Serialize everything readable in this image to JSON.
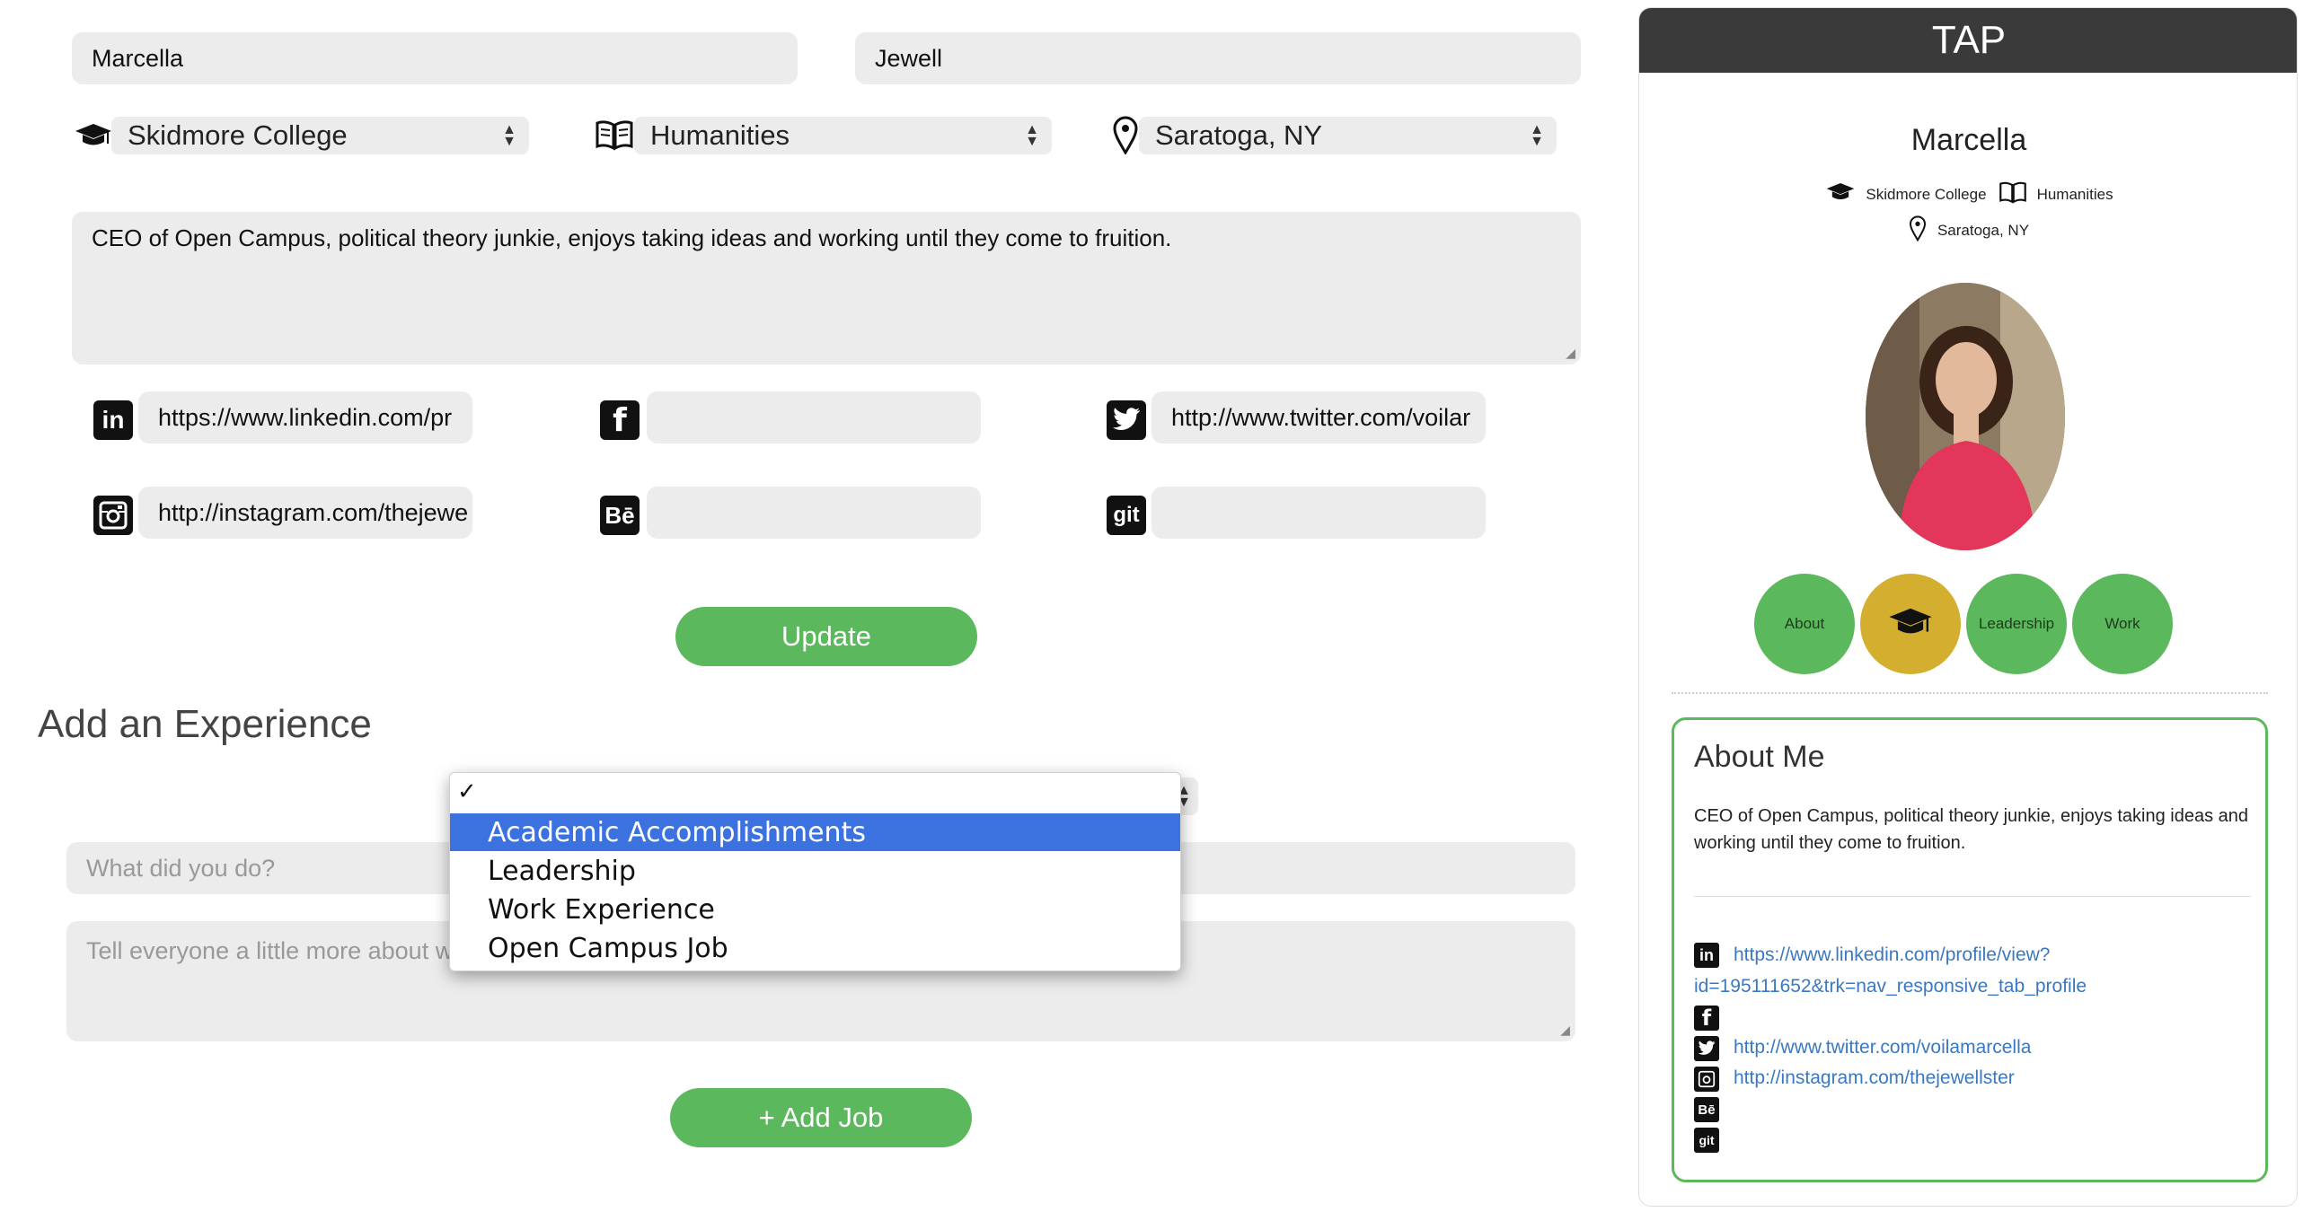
{
  "form": {
    "first_name": "Marcella",
    "last_name": "Jewell",
    "college": "Skidmore College",
    "major": "Humanities",
    "location": "Saratoga, NY",
    "bio": "CEO of Open Campus, political theory junkie, enjoys taking ideas and working until they come to fruition.",
    "linkedin_value": "https://www.linkedin.com/pr",
    "facebook_value": "",
    "twitter_value": "http://www.twitter.com/voilar",
    "instagram_value": "http://instagram.com/thejewe",
    "behance_value": "",
    "github_value": "",
    "update_label": "Update"
  },
  "experience": {
    "heading": "Add an Experience",
    "title_placeholder": "What did you do?",
    "details_placeholder": "Tell everyone a little more about w",
    "add_job_label": "+ Add Job",
    "dropdown": {
      "checkmark": "✓",
      "options": [
        "Academic Accomplishments",
        "Leadership",
        "Work Experience",
        "Open Campus Job"
      ],
      "highlighted": "Academic Accomplishments"
    }
  },
  "preview": {
    "header_title": "TAP",
    "name": "Marcella",
    "college": "Skidmore College",
    "major": "Humanities",
    "location": "Saratoga, NY",
    "tabs": [
      "About",
      "",
      "Leadership",
      "Work"
    ],
    "about_title": "About Me",
    "about_text": "CEO of Open Campus, political theory junkie, enjoys taking ideas and working until they come to fruition.",
    "linkedin_url_line1": "https://www.linkedin.com/profile/view?",
    "linkedin_url_line2": "id=195111652&trk=nav_responsive_tab_profile",
    "twitter_url": "http://www.twitter.com/voilamarcella",
    "instagram_url": "http://instagram.com/thejewellster"
  },
  "colors": {
    "accent_green": "#5cb85c",
    "selected_tab_gold": "#d4ae2e",
    "highlight_blue": "#3b72e0",
    "header_dark": "#3a3a3a"
  },
  "icons": {
    "college": "graduation-cap-icon",
    "major": "open-book-icon",
    "location": "map-pin-icon"
  }
}
